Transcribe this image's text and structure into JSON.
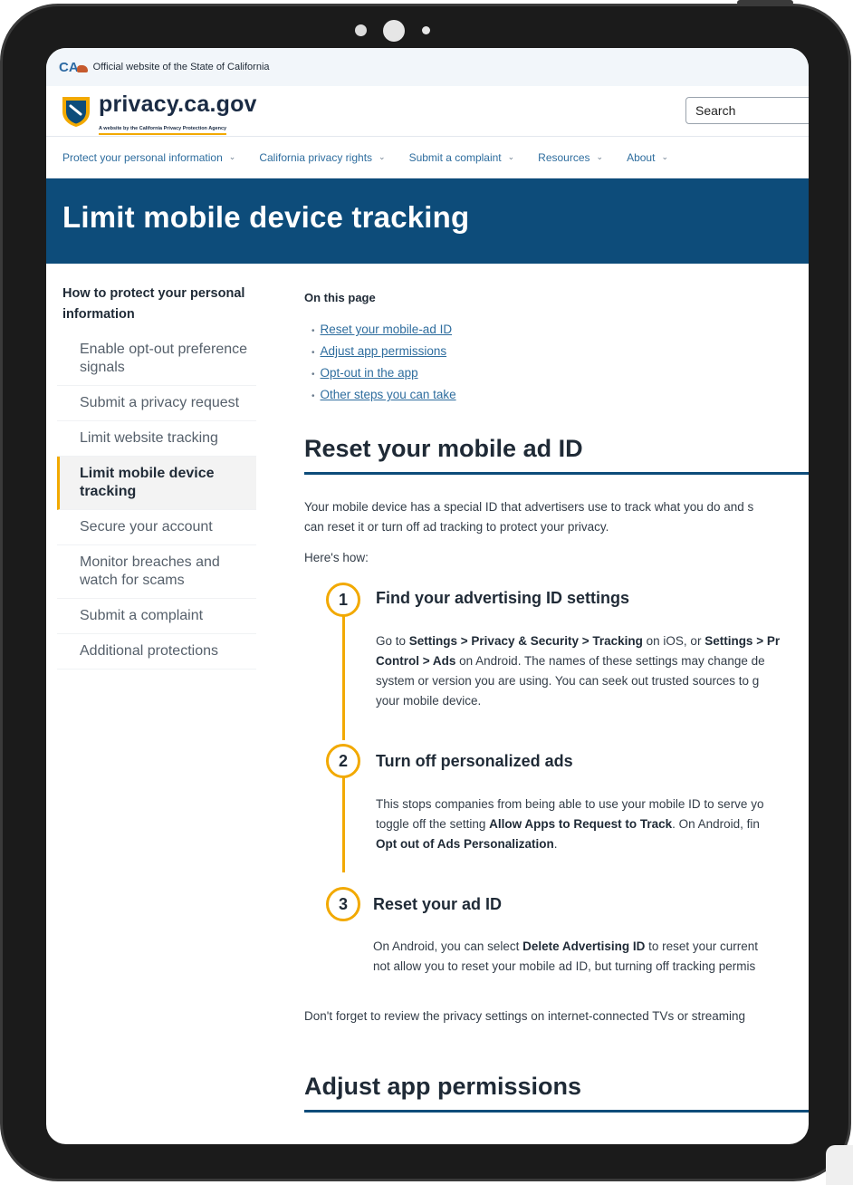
{
  "banner": {
    "logo_text": "CA",
    "text": "Official website of the State of California"
  },
  "header": {
    "brand_name": "privacy.ca.gov",
    "brand_tagline": "A website by the California Privacy Protection Agency",
    "search_placeholder": "Search"
  },
  "nav": {
    "items": [
      {
        "label": "Protect your personal information"
      },
      {
        "label": "California privacy rights"
      },
      {
        "label": "Submit a complaint"
      },
      {
        "label": "Resources"
      },
      {
        "label": "About"
      }
    ],
    "chevron": "⌄"
  },
  "hero": {
    "title": "Limit mobile device tracking"
  },
  "sidebar": {
    "title": "How to protect your personal information",
    "items": [
      {
        "label": "Enable opt-out preference signals",
        "active": false
      },
      {
        "label": "Submit a privacy request",
        "active": false
      },
      {
        "label": "Limit website tracking",
        "active": false
      },
      {
        "label": "Limit mobile device tracking",
        "active": true
      },
      {
        "label": "Secure your account",
        "active": false
      },
      {
        "label": "Monitor breaches and watch for scams",
        "active": false
      },
      {
        "label": "Submit a complaint",
        "active": false
      },
      {
        "label": "Additional protections",
        "active": false
      }
    ]
  },
  "toc": {
    "title": "On this page",
    "links": [
      "Reset your mobile-ad ID",
      "Adjust app permissions",
      "Opt-out in the app",
      "Other steps you can take"
    ]
  },
  "section1": {
    "heading": "Reset your mobile ad ID",
    "intro_line1": "Your mobile device has a special ID that advertisers use to track what you do and s",
    "intro_line2": "can reset it or turn off ad tracking to protect your privacy.",
    "howto": "Here's how:",
    "steps": [
      {
        "number": "1",
        "title": "Find your advertising ID settings",
        "b1": "Go to ",
        "b2": "Settings > Privacy & Security > Tracking",
        "b3": " on iOS, or ",
        "b4": "Settings > Pr",
        "b5": "Control > Ads",
        "b6": " on Android. The names of these settings may change de",
        "b7": "system or version you are using. You can seek out trusted sources to g",
        "b8": "your mobile device."
      },
      {
        "number": "2",
        "title": "Turn off personalized ads",
        "b1": "This stops companies from being able to use your mobile ID to serve yo",
        "b2": "toggle off the setting ",
        "b3": "Allow Apps to Request to Track",
        "b4": ". On Android, fin",
        "b5": "Opt out of Ads Personalization",
        "b6": "."
      },
      {
        "number": "3",
        "title": "Reset your ad ID",
        "b1": "On Android, you can select ",
        "b2": "Delete Advertising ID",
        "b3": " to reset your current",
        "b4": "not allow you to reset your mobile ad ID, but turning off tracking permis"
      }
    ],
    "footer_note": "Don't forget to review the privacy settings on internet-connected TVs or streaming"
  },
  "section2": {
    "heading": "Adjust app permissions"
  },
  "colors": {
    "brand_blue": "#0d4c7a",
    "link_blue": "#2e6d9e",
    "accent_gold": "#f2a900"
  }
}
